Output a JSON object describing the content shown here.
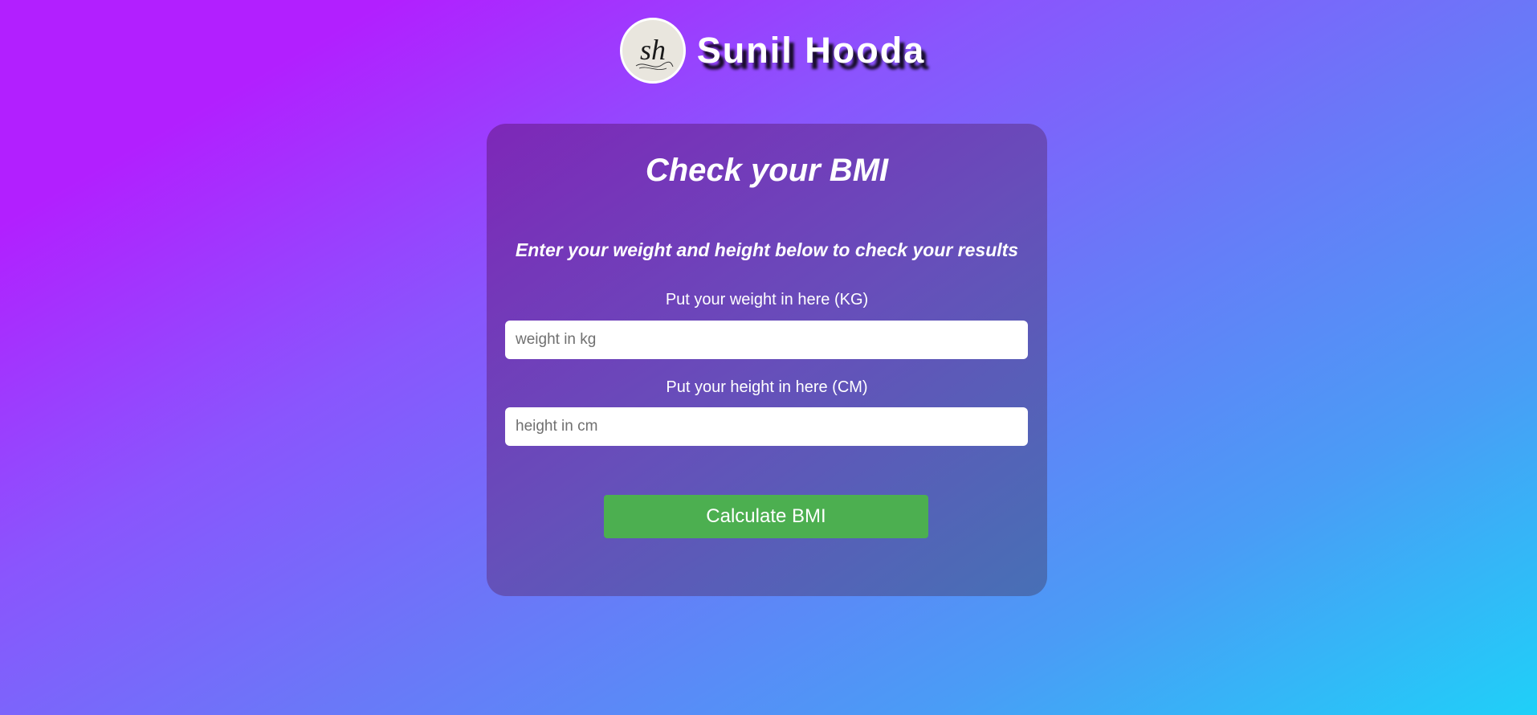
{
  "header": {
    "logo_text": "sh",
    "site_name": "Sunil Hooda"
  },
  "card": {
    "title": "Check your BMI",
    "subtitle": "Enter your weight and height below to check your results",
    "weight": {
      "label": "Put your weight in here (KG)",
      "placeholder": "weight in kg",
      "value": ""
    },
    "height": {
      "label": "Put your height in here (CM)",
      "placeholder": "height in cm",
      "value": ""
    },
    "button_label": "Calculate BMI"
  },
  "colors": {
    "button": "#4caf50",
    "gradient_start": "#b21fff",
    "gradient_end": "#1fd0f8"
  },
  "icons": {
    "logo": "signature-logo-icon"
  }
}
